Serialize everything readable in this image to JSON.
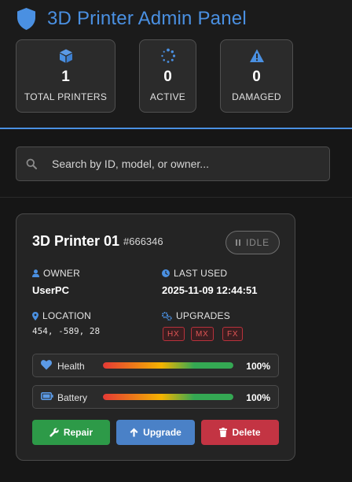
{
  "app": {
    "title": "3D Printer Admin Panel",
    "accent_color": "#4a90e2",
    "logo_icon": "shield-icon"
  },
  "stats": [
    {
      "icon": "cube-icon",
      "value": "1",
      "label": "TOTAL PRINTERS"
    },
    {
      "icon": "spinner-icon",
      "value": "0",
      "label": "ACTIVE"
    },
    {
      "icon": "warning-icon",
      "value": "0",
      "label": "DAMAGED"
    }
  ],
  "search": {
    "value": "",
    "placeholder": "Search by ID, model, or owner..."
  },
  "printer": {
    "name": "3D Printer 01",
    "id": "#666346",
    "status": "IDLE",
    "owner_label": "OWNER",
    "owner": "UserPC",
    "last_used_label": "LAST USED",
    "last_used": "2025-11-09 12:44:51",
    "location_label": "LOCATION",
    "location": "454, -589, 28",
    "upgrades_label": "UPGRADES",
    "upgrades": [
      "HX",
      "MX",
      "FX"
    ],
    "health_label": "Health",
    "health_pct": "100%",
    "health_value": 100,
    "battery_label": "Battery",
    "battery_pct": "100%",
    "battery_value": 100
  },
  "actions": {
    "repair": "Repair",
    "upgrade": "Upgrade",
    "delete": "Delete",
    "colors": {
      "repair": "#2d9a48",
      "upgrade": "#4a81c7",
      "delete": "#c33443"
    }
  }
}
